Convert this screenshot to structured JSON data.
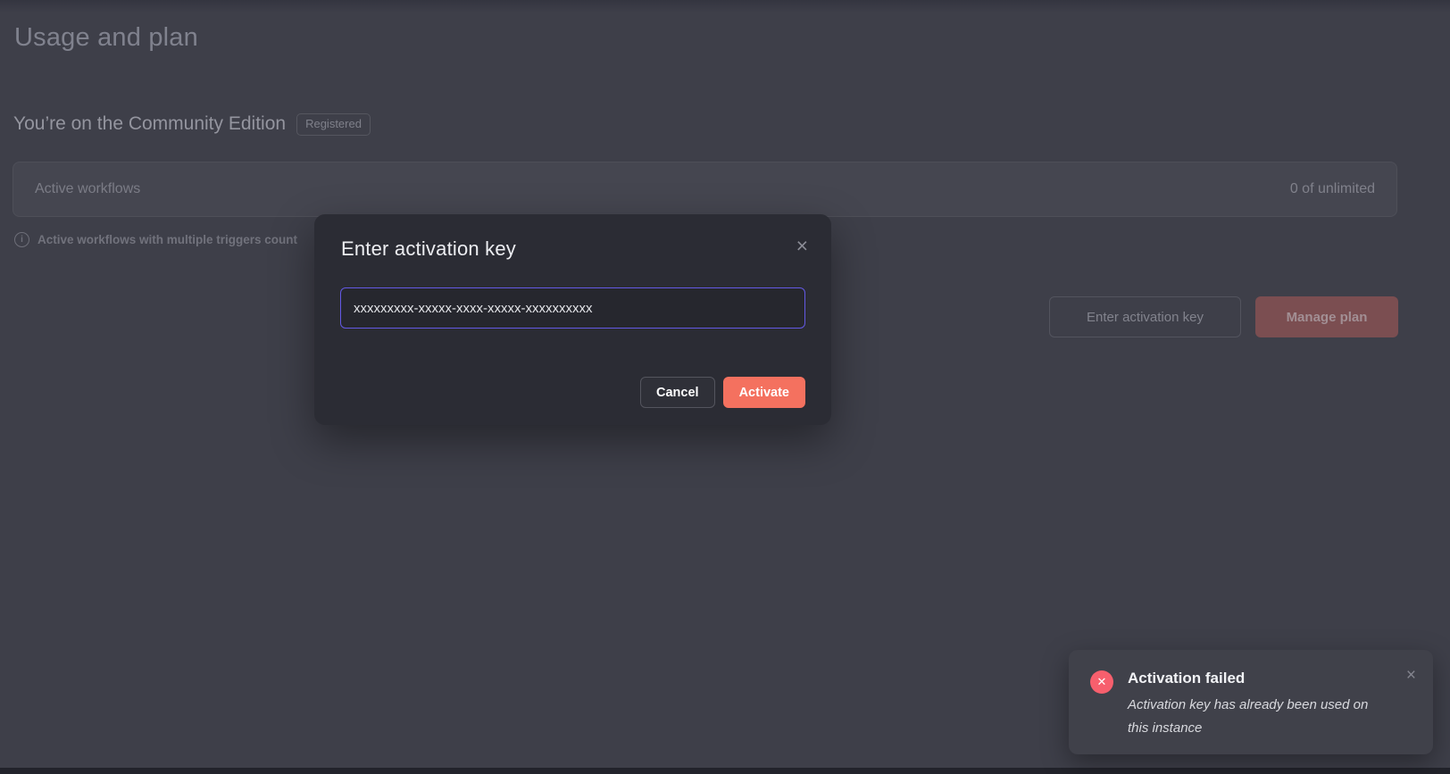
{
  "page": {
    "title": "Usage and plan",
    "plan_heading": "You’re on the Community Edition",
    "badge": "Registered",
    "usage_card": {
      "label": "Active workflows",
      "value": "0 of unlimited"
    },
    "info_note": "Active workflows with multiple triggers count",
    "buttons": {
      "enter_key": "Enter activation key",
      "manage_plan": "Manage plan"
    }
  },
  "modal": {
    "title": "Enter activation key",
    "input_value": "xxxxxxxxx-xxxxx-xxxx-xxxxx-xxxxxxxxxx",
    "cancel_label": "Cancel",
    "activate_label": "Activate"
  },
  "toast": {
    "title": "Activation failed",
    "message": "Activation key has already been used on this instance"
  },
  "icons": {
    "info": "i",
    "modal_close": "×",
    "toast_close": "×",
    "error_cross": "✕"
  },
  "colors": {
    "primary_accent": "#f4715f",
    "error": "#f75f6d",
    "input_focus_border": "#6359e4",
    "page_background": "#3e3f49",
    "modal_background": "#2b2c34",
    "toast_background": "#40414a"
  }
}
